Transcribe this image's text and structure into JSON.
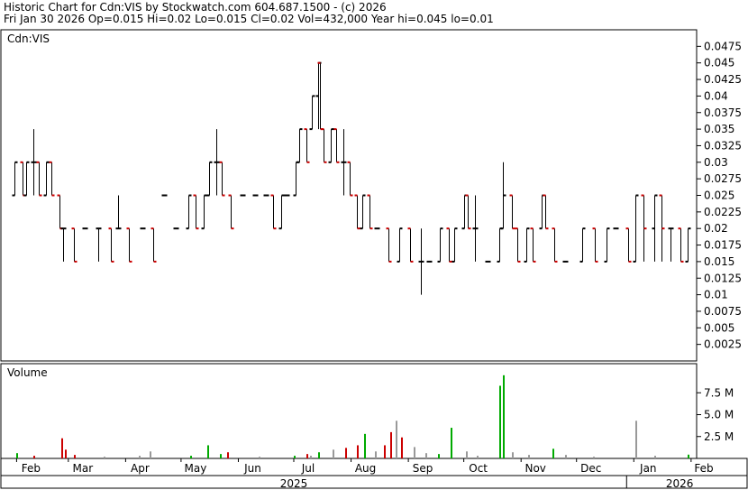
{
  "header": {
    "line1": "Historic Chart for Cdn:VIS by Stockwatch.com 604.687.1500 - (c) 2026",
    "line2": "Fri Jan 30 2026   Op=0.015   Hi=0.02   Lo=0.015   Cl=0.02   Vol=432,000   Year hi=0.045   lo=0.01"
  },
  "chart_data": [
    {
      "type": "ohlc",
      "panel_label": "Cdn:VIS",
      "ylim": [
        0,
        0.05
      ],
      "y_ticks": [
        "0.0475",
        "0.045",
        "0.0425",
        "0.04",
        "0.0375",
        "0.035",
        "0.0325",
        "0.03",
        "0.0275",
        "0.025",
        "0.0225",
        "0.02",
        "0.0175",
        "0.015",
        "0.0125",
        "0.01",
        "0.0075",
        "0.005",
        "0.0025"
      ],
      "x_months": [
        "Feb",
        "Mar",
        "Apr",
        "May",
        "Jun",
        "Jul",
        "Aug",
        "Sep",
        "Oct",
        "Nov",
        "Dec",
        "Jan",
        "Feb"
      ],
      "x_years": [
        "2025",
        "2026"
      ],
      "up_color": "#000000",
      "down_color": "#cc0000",
      "bars": [
        {
          "d": "2025-01-31",
          "o": 0.025,
          "h": 0.03,
          "l": 0.025,
          "c": 0.03
        },
        {
          "d": "2025-02-04",
          "o": 0.03,
          "h": 0.03,
          "l": 0.025,
          "c": 0.025
        },
        {
          "d": "2025-02-06",
          "o": 0.025,
          "h": 0.03,
          "l": 0.025,
          "c": 0.03
        },
        {
          "d": "2025-02-10",
          "o": 0.03,
          "h": 0.035,
          "l": 0.025,
          "c": 0.03
        },
        {
          "d": "2025-02-13",
          "o": 0.03,
          "h": 0.03,
          "l": 0.025,
          "c": 0.025
        },
        {
          "d": "2025-02-17",
          "o": 0.025,
          "h": 0.03,
          "l": 0.025,
          "c": 0.03
        },
        {
          "d": "2025-02-20",
          "o": 0.03,
          "h": 0.03,
          "l": 0.025,
          "c": 0.025
        },
        {
          "d": "2025-02-24",
          "o": 0.025,
          "h": 0.025,
          "l": 0.02,
          "c": 0.02
        },
        {
          "d": "2025-02-26",
          "o": 0.02,
          "h": 0.02,
          "l": 0.015,
          "c": 0.02
        },
        {
          "d": "2025-03-04",
          "o": 0.02,
          "h": 0.02,
          "l": 0.015,
          "c": 0.015
        },
        {
          "d": "2025-03-10",
          "o": 0.02,
          "h": 0.02,
          "l": 0.02,
          "c": 0.02
        },
        {
          "d": "2025-03-17",
          "o": 0.02,
          "h": 0.02,
          "l": 0.015,
          "c": 0.02
        },
        {
          "d": "2025-03-24",
          "o": 0.02,
          "h": 0.02,
          "l": 0.015,
          "c": 0.015
        },
        {
          "d": "2025-03-28",
          "o": 0.02,
          "h": 0.025,
          "l": 0.02,
          "c": 0.02
        },
        {
          "d": "2025-04-03",
          "o": 0.02,
          "h": 0.02,
          "l": 0.015,
          "c": 0.015
        },
        {
          "d": "2025-04-10",
          "o": 0.02,
          "h": 0.02,
          "l": 0.02,
          "c": 0.02
        },
        {
          "d": "2025-04-16",
          "o": 0.02,
          "h": 0.02,
          "l": 0.015,
          "c": 0.015
        },
        {
          "d": "2025-04-22",
          "o": 0.025,
          "h": 0.025,
          "l": 0.025,
          "c": 0.025
        },
        {
          "d": "2025-04-28",
          "o": 0.02,
          "h": 0.02,
          "l": 0.02,
          "c": 0.02
        },
        {
          "d": "2025-05-05",
          "o": 0.02,
          "h": 0.025,
          "l": 0.02,
          "c": 0.025
        },
        {
          "d": "2025-05-09",
          "o": 0.025,
          "h": 0.025,
          "l": 0.02,
          "c": 0.02
        },
        {
          "d": "2025-05-13",
          "o": 0.02,
          "h": 0.025,
          "l": 0.02,
          "c": 0.025
        },
        {
          "d": "2025-05-16",
          "o": 0.025,
          "h": 0.03,
          "l": 0.025,
          "c": 0.03
        },
        {
          "d": "2025-05-20",
          "o": 0.03,
          "h": 0.035,
          "l": 0.025,
          "c": 0.03
        },
        {
          "d": "2025-05-23",
          "o": 0.03,
          "h": 0.03,
          "l": 0.025,
          "c": 0.025
        },
        {
          "d": "2025-05-28",
          "o": 0.025,
          "h": 0.025,
          "l": 0.02,
          "c": 0.02
        },
        {
          "d": "2025-06-03",
          "o": 0.025,
          "h": 0.025,
          "l": 0.025,
          "c": 0.025
        },
        {
          "d": "2025-06-10",
          "o": 0.025,
          "h": 0.025,
          "l": 0.025,
          "c": 0.025
        },
        {
          "d": "2025-06-16",
          "o": 0.025,
          "h": 0.025,
          "l": 0.025,
          "c": 0.025
        },
        {
          "d": "2025-06-20",
          "o": 0.025,
          "h": 0.025,
          "l": 0.02,
          "c": 0.02
        },
        {
          "d": "2025-06-24",
          "o": 0.02,
          "h": 0.025,
          "l": 0.02,
          "c": 0.025
        },
        {
          "d": "2025-06-27",
          "o": 0.025,
          "h": 0.025,
          "l": 0.025,
          "c": 0.025
        },
        {
          "d": "2025-07-02",
          "o": 0.025,
          "h": 0.03,
          "l": 0.025,
          "c": 0.03
        },
        {
          "d": "2025-07-04",
          "o": 0.03,
          "h": 0.035,
          "l": 0.03,
          "c": 0.035
        },
        {
          "d": "2025-07-08",
          "o": 0.035,
          "h": 0.035,
          "l": 0.03,
          "c": 0.03
        },
        {
          "d": "2025-07-11",
          "o": 0.035,
          "h": 0.04,
          "l": 0.035,
          "c": 0.04
        },
        {
          "d": "2025-07-14",
          "o": 0.04,
          "h": 0.045,
          "l": 0.035,
          "c": 0.045
        },
        {
          "d": "2025-07-15",
          "o": 0.045,
          "h": 0.045,
          "l": 0.035,
          "c": 0.035
        },
        {
          "d": "2025-07-17",
          "o": 0.035,
          "h": 0.035,
          "l": 0.03,
          "c": 0.03
        },
        {
          "d": "2025-07-21",
          "o": 0.03,
          "h": 0.035,
          "l": 0.03,
          "c": 0.035
        },
        {
          "d": "2025-07-24",
          "o": 0.035,
          "h": 0.035,
          "l": 0.03,
          "c": 0.03
        },
        {
          "d": "2025-07-28",
          "o": 0.03,
          "h": 0.035,
          "l": 0.025,
          "c": 0.03
        },
        {
          "d": "2025-07-31",
          "o": 0.03,
          "h": 0.03,
          "l": 0.025,
          "c": 0.025
        },
        {
          "d": "2025-08-04",
          "o": 0.025,
          "h": 0.025,
          "l": 0.02,
          "c": 0.02
        },
        {
          "d": "2025-08-07",
          "o": 0.02,
          "h": 0.025,
          "l": 0.02,
          "c": 0.025
        },
        {
          "d": "2025-08-11",
          "o": 0.025,
          "h": 0.025,
          "l": 0.02,
          "c": 0.02
        },
        {
          "d": "2025-08-15",
          "o": 0.02,
          "h": 0.02,
          "l": 0.02,
          "c": 0.02
        },
        {
          "d": "2025-08-21",
          "o": 0.02,
          "h": 0.02,
          "l": 0.015,
          "c": 0.015
        },
        {
          "d": "2025-08-27",
          "o": 0.015,
          "h": 0.02,
          "l": 0.015,
          "c": 0.02
        },
        {
          "d": "2025-09-02",
          "o": 0.02,
          "h": 0.02,
          "l": 0.015,
          "c": 0.015
        },
        {
          "d": "2025-09-08",
          "o": 0.015,
          "h": 0.02,
          "l": 0.01,
          "c": 0.015
        },
        {
          "d": "2025-09-12",
          "o": 0.015,
          "h": 0.015,
          "l": 0.015,
          "c": 0.015
        },
        {
          "d": "2025-09-18",
          "o": 0.015,
          "h": 0.02,
          "l": 0.015,
          "c": 0.02
        },
        {
          "d": "2025-09-23",
          "o": 0.02,
          "h": 0.02,
          "l": 0.015,
          "c": 0.015
        },
        {
          "d": "2025-09-26",
          "o": 0.015,
          "h": 0.02,
          "l": 0.015,
          "c": 0.02
        },
        {
          "d": "2025-10-01",
          "o": 0.02,
          "h": 0.025,
          "l": 0.02,
          "c": 0.025
        },
        {
          "d": "2025-10-03",
          "o": 0.025,
          "h": 0.025,
          "l": 0.02,
          "c": 0.02
        },
        {
          "d": "2025-10-07",
          "o": 0.02,
          "h": 0.025,
          "l": 0.015,
          "c": 0.02
        },
        {
          "d": "2025-10-14",
          "o": 0.015,
          "h": 0.015,
          "l": 0.015,
          "c": 0.015
        },
        {
          "d": "2025-10-20",
          "o": 0.015,
          "h": 0.02,
          "l": 0.015,
          "c": 0.02
        },
        {
          "d": "2025-10-22",
          "o": 0.02,
          "h": 0.03,
          "l": 0.02,
          "c": 0.025
        },
        {
          "d": "2025-10-27",
          "o": 0.025,
          "h": 0.025,
          "l": 0.02,
          "c": 0.02
        },
        {
          "d": "2025-10-30",
          "o": 0.02,
          "h": 0.02,
          "l": 0.015,
          "c": 0.015
        },
        {
          "d": "2025-11-04",
          "o": 0.015,
          "h": 0.02,
          "l": 0.015,
          "c": 0.02
        },
        {
          "d": "2025-11-07",
          "o": 0.02,
          "h": 0.02,
          "l": 0.015,
          "c": 0.015
        },
        {
          "d": "2025-11-12",
          "o": 0.02,
          "h": 0.025,
          "l": 0.02,
          "c": 0.025
        },
        {
          "d": "2025-11-14",
          "o": 0.025,
          "h": 0.025,
          "l": 0.02,
          "c": 0.02
        },
        {
          "d": "2025-11-19",
          "o": 0.02,
          "h": 0.02,
          "l": 0.015,
          "c": 0.015
        },
        {
          "d": "2025-11-25",
          "o": 0.015,
          "h": 0.015,
          "l": 0.015,
          "c": 0.015
        },
        {
          "d": "2025-12-04",
          "o": 0.015,
          "h": 0.02,
          "l": 0.015,
          "c": 0.02
        },
        {
          "d": "2025-12-11",
          "o": 0.02,
          "h": 0.02,
          "l": 0.015,
          "c": 0.015
        },
        {
          "d": "2025-12-17",
          "o": 0.015,
          "h": 0.02,
          "l": 0.015,
          "c": 0.02
        },
        {
          "d": "2025-12-22",
          "o": 0.02,
          "h": 0.02,
          "l": 0.02,
          "c": 0.02
        },
        {
          "d": "2025-12-29",
          "o": 0.02,
          "h": 0.02,
          "l": 0.015,
          "c": 0.015
        },
        {
          "d": "2026-01-02",
          "o": 0.015,
          "h": 0.025,
          "l": 0.015,
          "c": 0.025
        },
        {
          "d": "2026-01-06",
          "o": 0.025,
          "h": 0.025,
          "l": 0.015,
          "c": 0.02
        },
        {
          "d": "2026-01-12",
          "o": 0.02,
          "h": 0.025,
          "l": 0.015,
          "c": 0.025
        },
        {
          "d": "2026-01-16",
          "o": 0.025,
          "h": 0.025,
          "l": 0.015,
          "c": 0.02
        },
        {
          "d": "2026-01-21",
          "o": 0.02,
          "h": 0.02,
          "l": 0.015,
          "c": 0.02
        },
        {
          "d": "2026-01-26",
          "o": 0.02,
          "h": 0.02,
          "l": 0.015,
          "c": 0.015
        },
        {
          "d": "2026-01-30",
          "o": 0.015,
          "h": 0.02,
          "l": 0.015,
          "c": 0.02
        }
      ]
    },
    {
      "type": "bar",
      "panel_label": "Volume",
      "ylim": [
        0,
        10000000
      ],
      "y_ticks": [
        "7.5 M",
        "5.0 M",
        "2.5 M"
      ],
      "y_tick_values": [
        7500000,
        5000000,
        2500000
      ],
      "colors": {
        "up": "#00aa00",
        "down": "#cc0000",
        "flat": "#999999"
      },
      "bars": [
        {
          "d": "2025-02-01",
          "v": 600000,
          "k": "up"
        },
        {
          "d": "2025-02-10",
          "v": 300000,
          "k": "down"
        },
        {
          "d": "2025-02-25",
          "v": 2300000,
          "k": "down"
        },
        {
          "d": "2025-02-27",
          "v": 1000000,
          "k": "down"
        },
        {
          "d": "2025-03-04",
          "v": 400000,
          "k": "down"
        },
        {
          "d": "2025-03-20",
          "v": 200000,
          "k": "flat"
        },
        {
          "d": "2025-04-08",
          "v": 300000,
          "k": "flat"
        },
        {
          "d": "2025-04-14",
          "v": 800000,
          "k": "flat"
        },
        {
          "d": "2025-05-06",
          "v": 300000,
          "k": "up"
        },
        {
          "d": "2025-05-15",
          "v": 1500000,
          "k": "up"
        },
        {
          "d": "2025-05-22",
          "v": 500000,
          "k": "up"
        },
        {
          "d": "2025-05-26",
          "v": 700000,
          "k": "down"
        },
        {
          "d": "2025-06-12",
          "v": 200000,
          "k": "flat"
        },
        {
          "d": "2025-07-01",
          "v": 300000,
          "k": "up"
        },
        {
          "d": "2025-07-08",
          "v": 500000,
          "k": "down"
        },
        {
          "d": "2025-07-10",
          "v": 300000,
          "k": "flat"
        },
        {
          "d": "2025-07-14",
          "v": 700000,
          "k": "up"
        },
        {
          "d": "2025-07-22",
          "v": 1000000,
          "k": "flat"
        },
        {
          "d": "2025-07-29",
          "v": 1200000,
          "k": "down"
        },
        {
          "d": "2025-08-04",
          "v": 1500000,
          "k": "down"
        },
        {
          "d": "2025-08-08",
          "v": 2800000,
          "k": "up"
        },
        {
          "d": "2025-08-14",
          "v": 800000,
          "k": "flat"
        },
        {
          "d": "2025-08-19",
          "v": 1500000,
          "k": "down"
        },
        {
          "d": "2025-08-22",
          "v": 3000000,
          "k": "down"
        },
        {
          "d": "2025-08-25",
          "v": 4300000,
          "k": "flat"
        },
        {
          "d": "2025-08-28",
          "v": 2400000,
          "k": "down"
        },
        {
          "d": "2025-09-04",
          "v": 1300000,
          "k": "flat"
        },
        {
          "d": "2025-09-10",
          "v": 600000,
          "k": "flat"
        },
        {
          "d": "2025-09-17",
          "v": 500000,
          "k": "up"
        },
        {
          "d": "2025-09-24",
          "v": 3500000,
          "k": "up"
        },
        {
          "d": "2025-10-02",
          "v": 800000,
          "k": "flat"
        },
        {
          "d": "2025-10-08",
          "v": 300000,
          "k": "flat"
        },
        {
          "d": "2025-10-20",
          "v": 8300000,
          "k": "up"
        },
        {
          "d": "2025-10-22",
          "v": 9500000,
          "k": "up"
        },
        {
          "d": "2025-10-27",
          "v": 700000,
          "k": "flat"
        },
        {
          "d": "2025-11-05",
          "v": 400000,
          "k": "flat"
        },
        {
          "d": "2025-11-18",
          "v": 1100000,
          "k": "up"
        },
        {
          "d": "2025-11-25",
          "v": 400000,
          "k": "flat"
        },
        {
          "d": "2025-12-10",
          "v": 200000,
          "k": "flat"
        },
        {
          "d": "2026-01-02",
          "v": 4300000,
          "k": "flat"
        },
        {
          "d": "2026-01-12",
          "v": 300000,
          "k": "flat"
        },
        {
          "d": "2026-01-30",
          "v": 432000,
          "k": "up"
        }
      ]
    }
  ]
}
